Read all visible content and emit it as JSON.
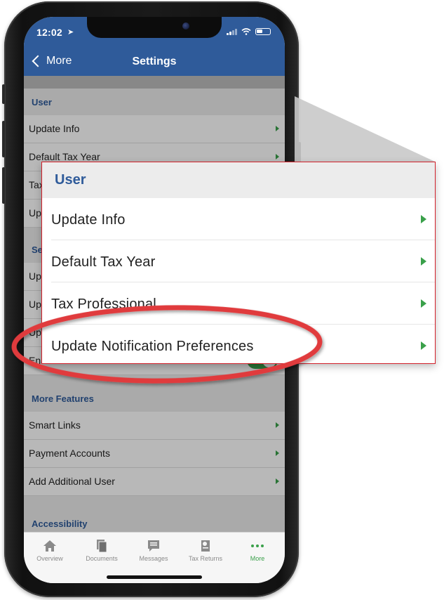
{
  "status_bar": {
    "time": "12:02"
  },
  "nav": {
    "back_label": "More",
    "title": "Settings"
  },
  "phone_list": {
    "user_section": {
      "header": "User",
      "items": [
        "Update Info",
        "Default Tax Year",
        "Tax",
        "Upd"
      ]
    },
    "security_section": {
      "header": "Sec",
      "items": [
        "Upd",
        "Upd",
        "Upd"
      ],
      "toggle_item": "Enable Face ID",
      "toggle_on": true
    },
    "more_features_section": {
      "header": "More Features",
      "items": [
        "Smart Links",
        "Payment Accounts",
        "Add Additional User"
      ]
    },
    "accessibility_section": {
      "header": "Accessibility"
    }
  },
  "tab_bar": {
    "tabs": [
      {
        "label": "Overview",
        "icon": "home-icon"
      },
      {
        "label": "Documents",
        "icon": "documents-icon"
      },
      {
        "label": "Messages",
        "icon": "messages-icon"
      },
      {
        "label": "Tax Returns",
        "icon": "tax-returns-icon"
      },
      {
        "label": "More",
        "icon": "more-dots-icon"
      }
    ],
    "active": "More"
  },
  "callout": {
    "header": "User",
    "items": [
      "Update Info",
      "Default Tax Year",
      "Tax Professional",
      "Update Notification Preferences"
    ],
    "highlighted_item": "Update Notification Preferences"
  },
  "colors": {
    "nav_blue": "#2f5b9a",
    "accent_green": "#3aa04a",
    "highlight_red": "#e03a3e"
  }
}
